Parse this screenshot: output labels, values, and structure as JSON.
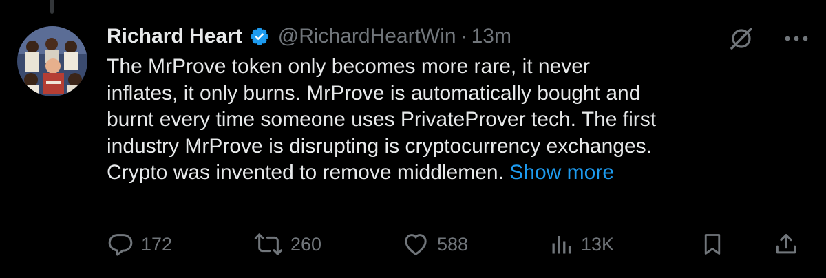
{
  "tweet": {
    "display_name": "Richard Heart",
    "handle": "@RichardHeartWin",
    "separator": "·",
    "timestamp": "13m",
    "text_lines": [
      "The MrProve token only becomes more rare, it never",
      "inflates, it only burns. MrProve is automatically bought and",
      "burnt every time someone uses PrivateProver tech. The first",
      "industry MrProve is disrupting is cryptocurrency exchanges.",
      "Crypto was invented to remove middlemen."
    ],
    "show_more_label": "Show more",
    "verified_icon": "verified-badge-icon",
    "header_icons": [
      "grok-icon",
      "more-options-icon"
    ]
  },
  "actions": {
    "replies": "172",
    "reposts": "260",
    "likes": "588",
    "views": "13K",
    "icons": [
      "reply-icon",
      "repost-icon",
      "like-icon",
      "views-icon",
      "bookmark-icon",
      "share-icon"
    ]
  },
  "colors": {
    "background": "#000000",
    "text": "#e7e9ea",
    "secondary": "#71767b",
    "accent": "#1d9bf0"
  }
}
